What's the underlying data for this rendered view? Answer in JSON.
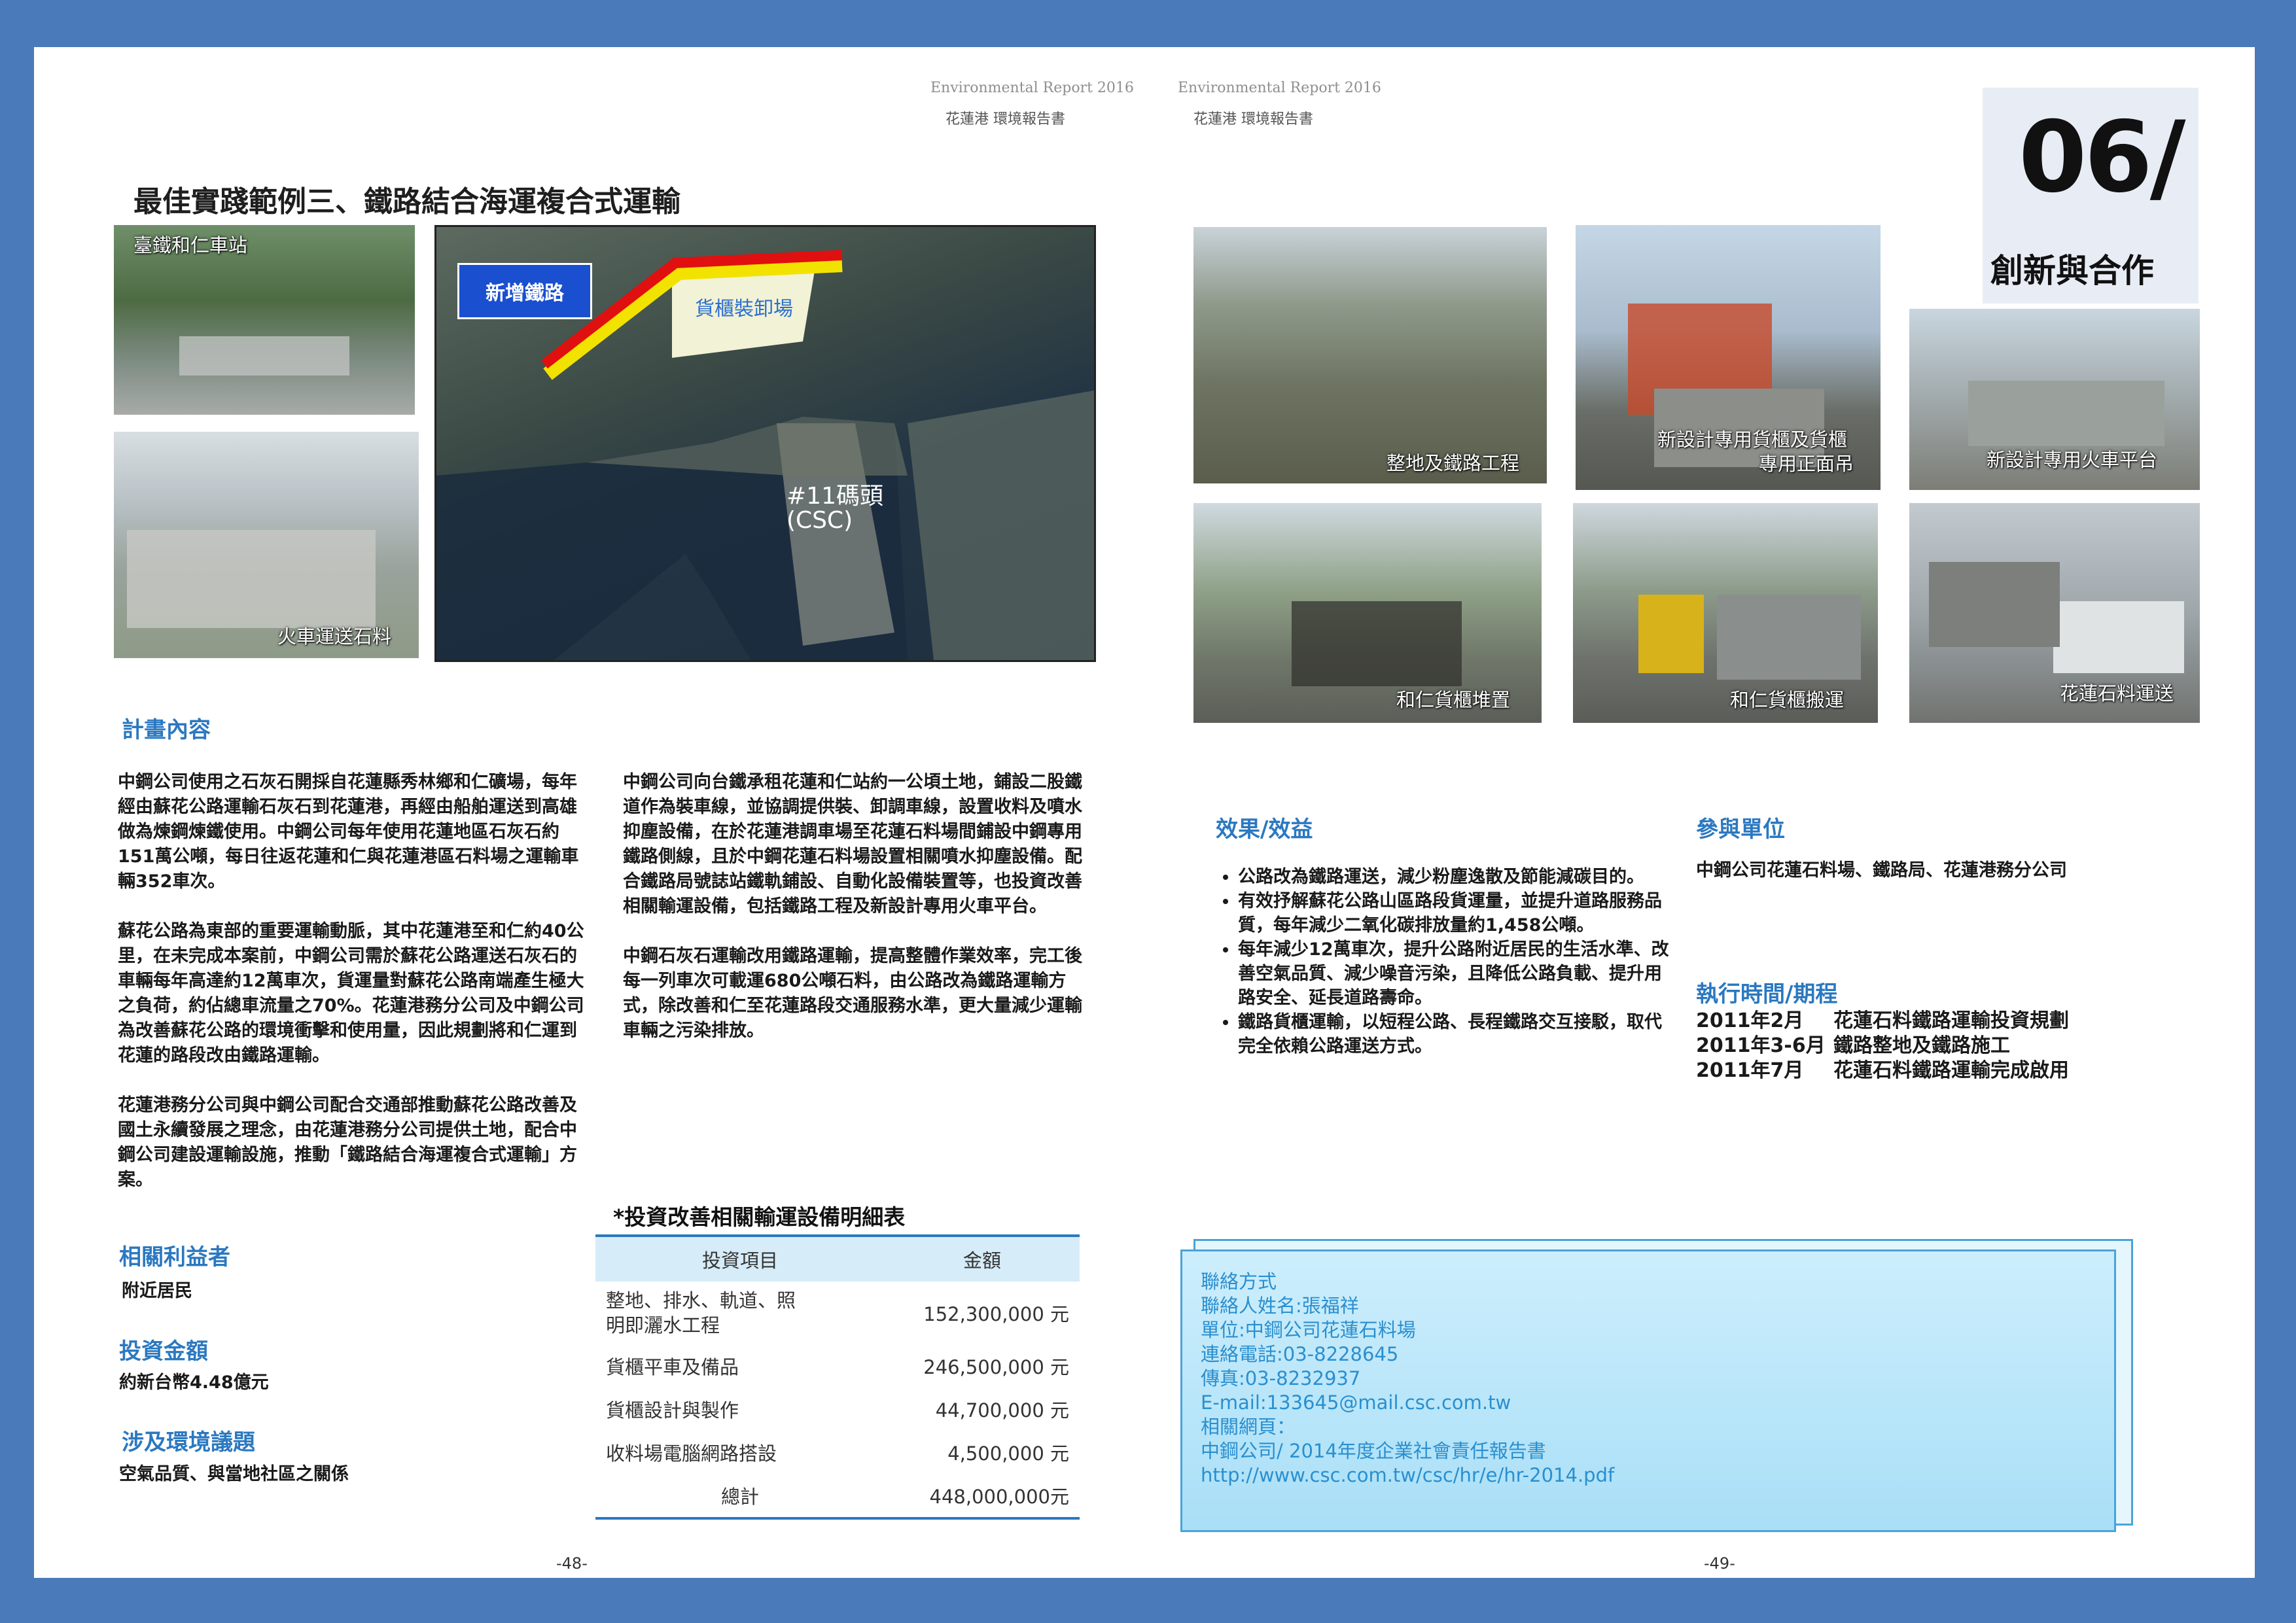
{
  "header": {
    "left_en": "Environmental Report 2016",
    "left_zh": "花蓮港  環境報告書",
    "right_en": "Environmental Report 2016",
    "right_zh": "花蓮港  環境報告書"
  },
  "chapter": {
    "number": "06/",
    "title": "創新與合作"
  },
  "title": "最佳實踐範例三、鐵路結合海運複合式運輸",
  "left_photos": {
    "heren_station": "臺鐵和仁車站",
    "train_stone": "火車運送石料",
    "map_new_rail": "新增鐵路",
    "map_yard": "貨櫃裝卸場",
    "map_pier_line1": "#11碼頭",
    "map_pier_line2": "(CSC)"
  },
  "right_photos": {
    "p1": "整地及鐵路工程",
    "p2_line1": "新設計專用貨櫃及貨櫃",
    "p2_line2": "專用正面吊",
    "p3": "新設計專用火車平台",
    "p4": "和仁貨櫃堆置",
    "p5": "和仁貨櫃搬運",
    "p6": "花蓮石料運送"
  },
  "plan": {
    "heading": "計畫內容",
    "col1_p1": "中鋼公司使用之石灰石開採自花蓮縣秀林鄉和仁礦場，每年經由蘇花公路運輸石灰石到花蓮港，再經由船舶運送到高雄做為煉鋼煉鐵使用。中鋼公司每年使用花蓮地區石灰石約151萬公噸，每日往返花蓮和仁與花蓮港區石料場之運輸車輛352車次。",
    "col1_p2": "蘇花公路為東部的重要運輸動脈，其中花蓮港至和仁約40公里，在未完成本案前，中鋼公司需於蘇花公路運送石灰石的車輛每年高達約12萬車次，貨運量對蘇花公路南端產生極大之負荷，約佔總車流量之70%。花蓮港務分公司及中鋼公司為改善蘇花公路的環境衝擊和使用量，因此規劃將和仁運到花蓮的路段改由鐵路運輸。",
    "col1_p3": "花蓮港務分公司與中鋼公司配合交通部推動蘇花公路改善及國土永續發展之理念，由花蓮港務分公司提供土地，配合中鋼公司建設運輸設施，推動「鐵路結合海運複合式運輸」方案。",
    "col2_p1": "中鋼公司向台鐵承租花蓮和仁站約一公頃土地，鋪設二股鐵道作為裝車線，並協調提供裝、卸調車線，設置收料及噴水抑塵設備，在於花蓮港調車場至花蓮石料場間鋪設中鋼專用鐵路側線，且於中鋼花蓮石料場設置相關噴水抑塵設備。配合鐵路局號誌站鐵軌鋪設、自動化設備裝置等，也投資改善相關輸運設備，包括鐵路工程及新設計專用火車平台。",
    "col2_p2": "中鋼石灰石運輸改用鐵路運輸，提高整體作業效率，完工後每一列車次可載運680公噸石料，由公路改為鐵路運輸方式，除改善和仁至花蓮路段交通服務水準，更大量減少運輸車輛之污染排放。"
  },
  "stakeholders": {
    "heading": "相關利益者",
    "value": "附近居民"
  },
  "investment": {
    "heading": "投資金額",
    "value": "約新台幣4.48億元"
  },
  "issues": {
    "heading": "涉及環境議題",
    "value": "空氣品質、與當地社區之關係"
  },
  "table": {
    "title": "*投資改善相關輸運設備明細表",
    "col_item": "投資項目",
    "col_amount": "金額",
    "rows": [
      {
        "item_line1": "整地、排水、軌道、照",
        "item_line2": "明即灑水工程",
        "amount": "152,300,000 元"
      },
      {
        "item_line1": "貨櫃平車及備品",
        "item_line2": "",
        "amount": "246,500,000 元"
      },
      {
        "item_line1": "貨櫃設計與製作",
        "item_line2": "",
        "amount": "44,700,000 元"
      },
      {
        "item_line1": "收料場電腦網路搭設",
        "item_line2": "",
        "amount": "4,500,000 元"
      }
    ],
    "total_label": "總計",
    "total_amount": "448,000,000元"
  },
  "benefits": {
    "heading": "效果/效益",
    "items": [
      "公路改為鐵路運送，減少粉塵逸散及節能減碳目的。",
      "有效抒解蘇花公路山區路段貨運量，並提升道路服務品質，每年減少二氧化碳排放量約1,458公噸。",
      "每年減少12萬車次，提升公路附近居民的生活水準、改善空氣品質、減少噪音污染，且降低公路負載、提升用路安全、延長道路壽命。",
      "鐵路貨櫃運輸，以短程公路、長程鐵路交互接駁，取代完全依賴公路運送方式。"
    ]
  },
  "participants": {
    "heading": "參與單位",
    "value": "中鋼公司花蓮石料場、鐵路局、花蓮港務分公司"
  },
  "schedule": {
    "heading": "執行時間/期程",
    "rows": [
      {
        "date": "2011年2月",
        "desc": "花蓮石料鐵路運輸投資規劃"
      },
      {
        "date": "2011年3-6月",
        "desc": "鐵路整地及鐵路施工"
      },
      {
        "date": "2011年7月",
        "desc": "花蓮石料鐵路運輸完成啟用"
      }
    ]
  },
  "contact": {
    "label": "聯絡方式",
    "person": "聯絡人姓名:張福祥",
    "unit": "單位:中鋼公司花蓮石料場",
    "phone": "連絡電話:03-8228645",
    "fax": "傳真:03-8232937",
    "email": "E-mail:133645@mail.csc.com.tw",
    "web_label": "相關網頁：",
    "web_title": "中鋼公司/ 2014年度企業社會責任報告書",
    "url": "http://www.csc.com.tw/csc/hr/e/hr-2014.pdf"
  },
  "page_numbers": {
    "left": "-48-",
    "right": "-49-"
  }
}
